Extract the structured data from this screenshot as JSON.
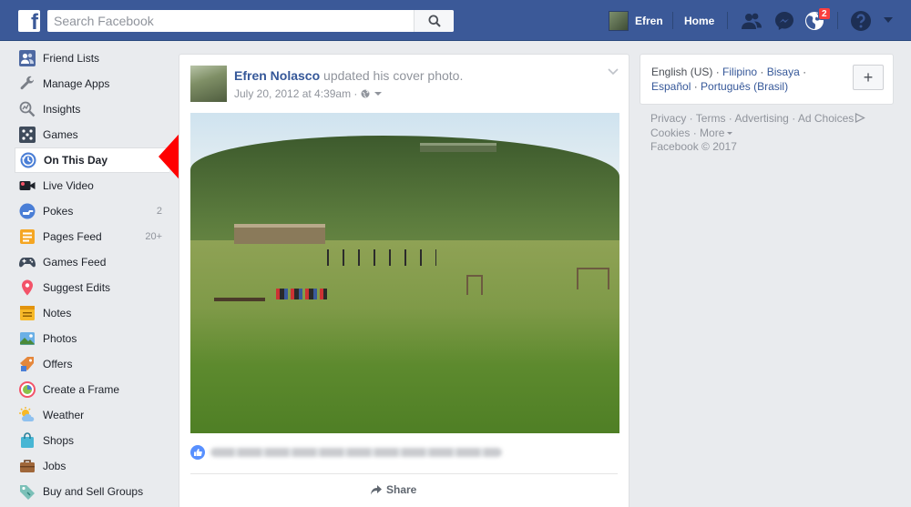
{
  "topbar": {
    "logo": "f",
    "search_placeholder": "Search Facebook",
    "profile_name": "Efren",
    "home_label": "Home",
    "notification_count": "2"
  },
  "sidebar": {
    "items": [
      {
        "label": "Friend Lists",
        "icon": "friend-lists-icon"
      },
      {
        "label": "Manage Apps",
        "icon": "wrench-icon"
      },
      {
        "label": "Insights",
        "icon": "insights-icon"
      },
      {
        "label": "Games",
        "icon": "games-icon"
      },
      {
        "label": "On This Day",
        "icon": "on-this-day-icon",
        "active": true
      },
      {
        "label": "Live Video",
        "icon": "video-camera-icon"
      },
      {
        "label": "Pokes",
        "icon": "poke-icon",
        "count": "2"
      },
      {
        "label": "Pages Feed",
        "icon": "pages-feed-icon",
        "count": "20+"
      },
      {
        "label": "Games Feed",
        "icon": "gamepad-icon"
      },
      {
        "label": "Suggest Edits",
        "icon": "map-pin-icon"
      },
      {
        "label": "Notes",
        "icon": "notes-icon"
      },
      {
        "label": "Photos",
        "icon": "photos-icon"
      },
      {
        "label": "Offers",
        "icon": "offers-icon"
      },
      {
        "label": "Create a Frame",
        "icon": "frame-icon"
      },
      {
        "label": "Weather",
        "icon": "weather-icon"
      },
      {
        "label": "Shops",
        "icon": "shopping-bag-icon"
      },
      {
        "label": "Jobs",
        "icon": "briefcase-icon"
      },
      {
        "label": "Buy and Sell Groups",
        "icon": "tag-icon"
      }
    ]
  },
  "post": {
    "author": "Efren Nolasco",
    "action": " updated his cover photo.",
    "timestamp": "July 20, 2012 at 4:39am",
    "meta_sep": " · ",
    "share_label": "Share"
  },
  "right": {
    "languages": {
      "current": "English (US)",
      "others": [
        "Filipino",
        "Bisaya",
        "Español",
        "Português (Brasil)"
      ]
    },
    "add_label": "+",
    "footer": [
      "Privacy",
      "Terms",
      "Advertising",
      "Ad Choices",
      "Cookies",
      "More"
    ],
    "copyright": "Facebook © 2017"
  },
  "colors": {
    "brand": "#3b5998",
    "link": "#365899",
    "badge": "#fa3e3e",
    "arrow": "#ff0000"
  }
}
